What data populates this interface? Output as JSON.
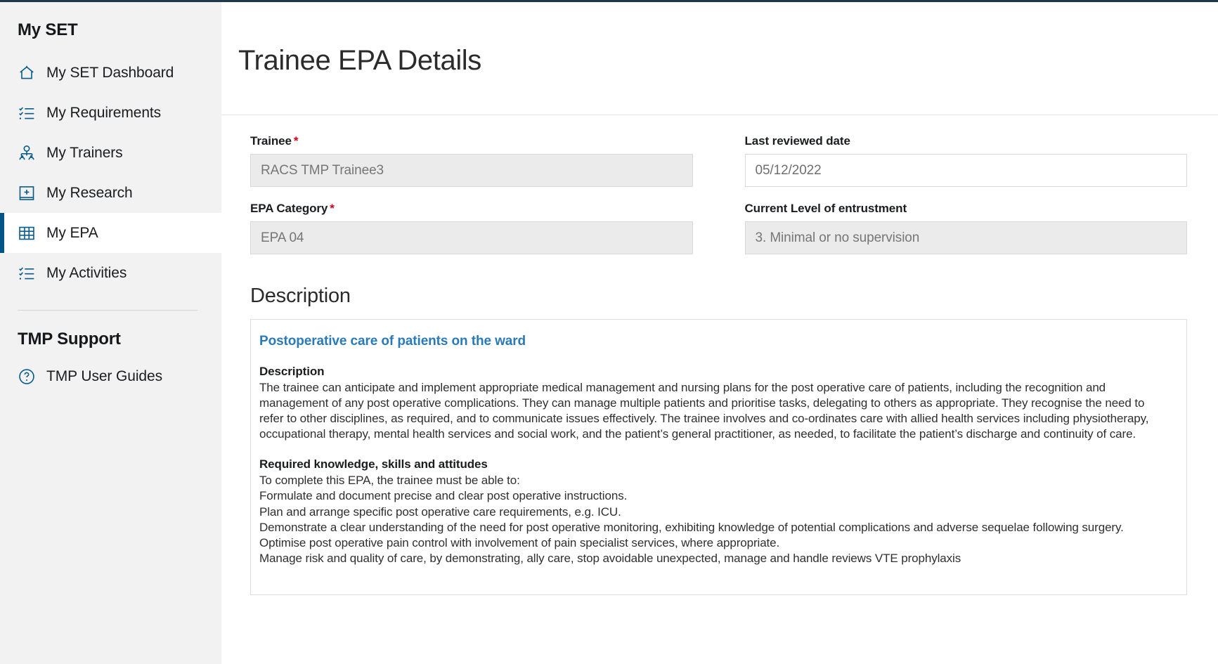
{
  "sidebar": {
    "section1_title": "My SET",
    "items": [
      {
        "label": "My SET Dashboard",
        "icon": "home-icon",
        "active": false
      },
      {
        "label": "My Requirements",
        "icon": "checklist-icon",
        "active": false
      },
      {
        "label": "My Trainers",
        "icon": "people-icon",
        "active": false
      },
      {
        "label": "My Research",
        "icon": "book-plus-icon",
        "active": false
      },
      {
        "label": "My EPA",
        "icon": "table-icon",
        "active": true
      },
      {
        "label": "My Activities",
        "icon": "checklist-icon",
        "active": false
      }
    ],
    "section2_title": "TMP Support",
    "support_items": [
      {
        "label": "TMP User Guides",
        "icon": "question-circle-icon"
      }
    ]
  },
  "header": {
    "title": "Trainee EPA Details"
  },
  "form": {
    "left": [
      {
        "label": "Trainee",
        "required": true,
        "value": "RACS TMP Trainee3",
        "disabled": true
      },
      {
        "label": "EPA Category",
        "required": true,
        "value": "EPA 04",
        "disabled": true
      }
    ],
    "right": [
      {
        "label": "Last reviewed date",
        "required": false,
        "value": "05/12/2022",
        "disabled": false
      },
      {
        "label": "Current Level of entrustment",
        "required": false,
        "value": "3. Minimal or no supervision",
        "disabled": true
      }
    ]
  },
  "description": {
    "section_heading": "Description",
    "card_title": "Postoperative care of patients on the ward",
    "blocks": [
      {
        "heading": "Description",
        "lines": [
          "The trainee can anticipate and implement appropriate medical management and nursing plans for the post operative care of patients, including the recognition and management of any post operative complications. They can manage multiple patients and prioritise tasks, delegating to others as appropriate. They recognise the need to refer to other disciplines, as required, and to communicate issues effectively.  The trainee involves and co-ordinates care with allied health services including physiotherapy, occupational therapy, mental health services and social work, and the patient’s general practitioner, as needed, to facilitate the patient’s discharge and continuity of care."
        ]
      },
      {
        "heading": "Required knowledge, skills and attitudes",
        "lines": [
          "To complete this EPA, the trainee must be able to:",
          "Formulate and document precise and clear post operative instructions.",
          "Plan and arrange specific post operative care requirements, e.g. ICU.",
          "Demonstrate a clear understanding of the need for post operative monitoring, exhibiting knowledge of potential complications and adverse sequelae following surgery.",
          "Optimise post operative pain control with involvement of pain specialist services, where appropriate.",
          "Manage risk and quality of care, by demonstrating, ally care, stop avoidable unexpected, manage and handle reviews VTE prophylaxis"
        ]
      }
    ]
  },
  "colors": {
    "accent": "#005587",
    "icon_blue": "#0a5c8a",
    "link_blue": "#2a7ab9",
    "required_red": "#d0021b",
    "sidebar_bg": "#f2f2f2",
    "disabled_field_bg": "#ebebeb"
  }
}
